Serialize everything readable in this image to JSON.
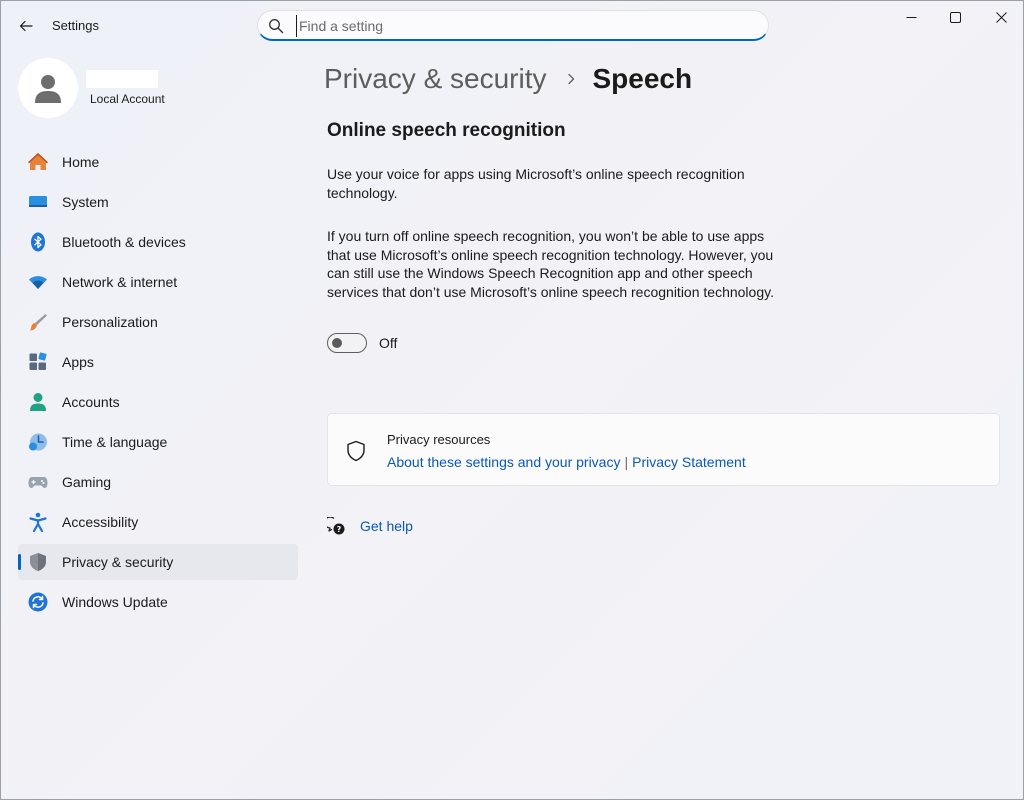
{
  "window": {
    "title": "Settings",
    "controls": {
      "minimize": "minimize-icon",
      "maximize": "maximize-icon",
      "close": "close-icon"
    }
  },
  "search": {
    "placeholder": "Find a setting",
    "value": ""
  },
  "profile": {
    "name": "",
    "account_type": "Local Account"
  },
  "nav": {
    "items": [
      {
        "label": "Home",
        "icon": "home-icon",
        "selected": false
      },
      {
        "label": "System",
        "icon": "system-icon",
        "selected": false
      },
      {
        "label": "Bluetooth & devices",
        "icon": "bluetooth-icon",
        "selected": false
      },
      {
        "label": "Network & internet",
        "icon": "wifi-icon",
        "selected": false
      },
      {
        "label": "Personalization",
        "icon": "brush-icon",
        "selected": false
      },
      {
        "label": "Apps",
        "icon": "apps-icon",
        "selected": false
      },
      {
        "label": "Accounts",
        "icon": "accounts-icon",
        "selected": false
      },
      {
        "label": "Time & language",
        "icon": "time-language-icon",
        "selected": false
      },
      {
        "label": "Gaming",
        "icon": "gamepad-icon",
        "selected": false
      },
      {
        "label": "Accessibility",
        "icon": "accessibility-icon",
        "selected": false
      },
      {
        "label": "Privacy & security",
        "icon": "shield-icon",
        "selected": true
      },
      {
        "label": "Windows Update",
        "icon": "update-icon",
        "selected": false
      }
    ]
  },
  "breadcrumb": {
    "parent": "Privacy & security",
    "current": "Speech"
  },
  "content": {
    "section_title": "Online speech recognition",
    "description": "Use your voice for apps using Microsoft’s online speech recognition technology.",
    "warning": "If you turn off online speech recognition, you won’t be able to use apps that use Microsoft’s online speech recognition technology.  However, you can still use the Windows Speech Recognition app and other speech services that don’t use Microsoft’s online speech recognition technology.",
    "toggle": {
      "state": "off",
      "label": "Off"
    }
  },
  "resources": {
    "title": "Privacy resources",
    "link1": "About these settings and your privacy",
    "separator": "|",
    "link2": "Privacy Statement"
  },
  "help": {
    "label": "Get help"
  },
  "colors": {
    "accent": "#0067c0",
    "link": "#0a58b8"
  }
}
